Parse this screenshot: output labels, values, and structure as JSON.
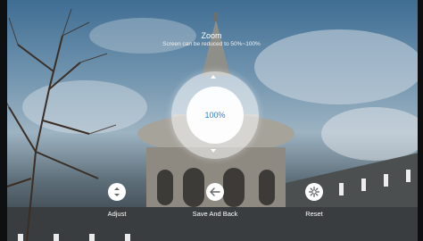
{
  "zoom": {
    "title": "Zoom",
    "subtitle": "Screen can be reduced to 50%~100%",
    "value": "100%"
  },
  "actions": [
    {
      "label": "Adjust",
      "icon": "adjust-vertical-icon"
    },
    {
      "label": "Save And Back",
      "icon": "arrow-left-icon"
    },
    {
      "label": "Reset",
      "icon": "gear-icon"
    }
  ]
}
